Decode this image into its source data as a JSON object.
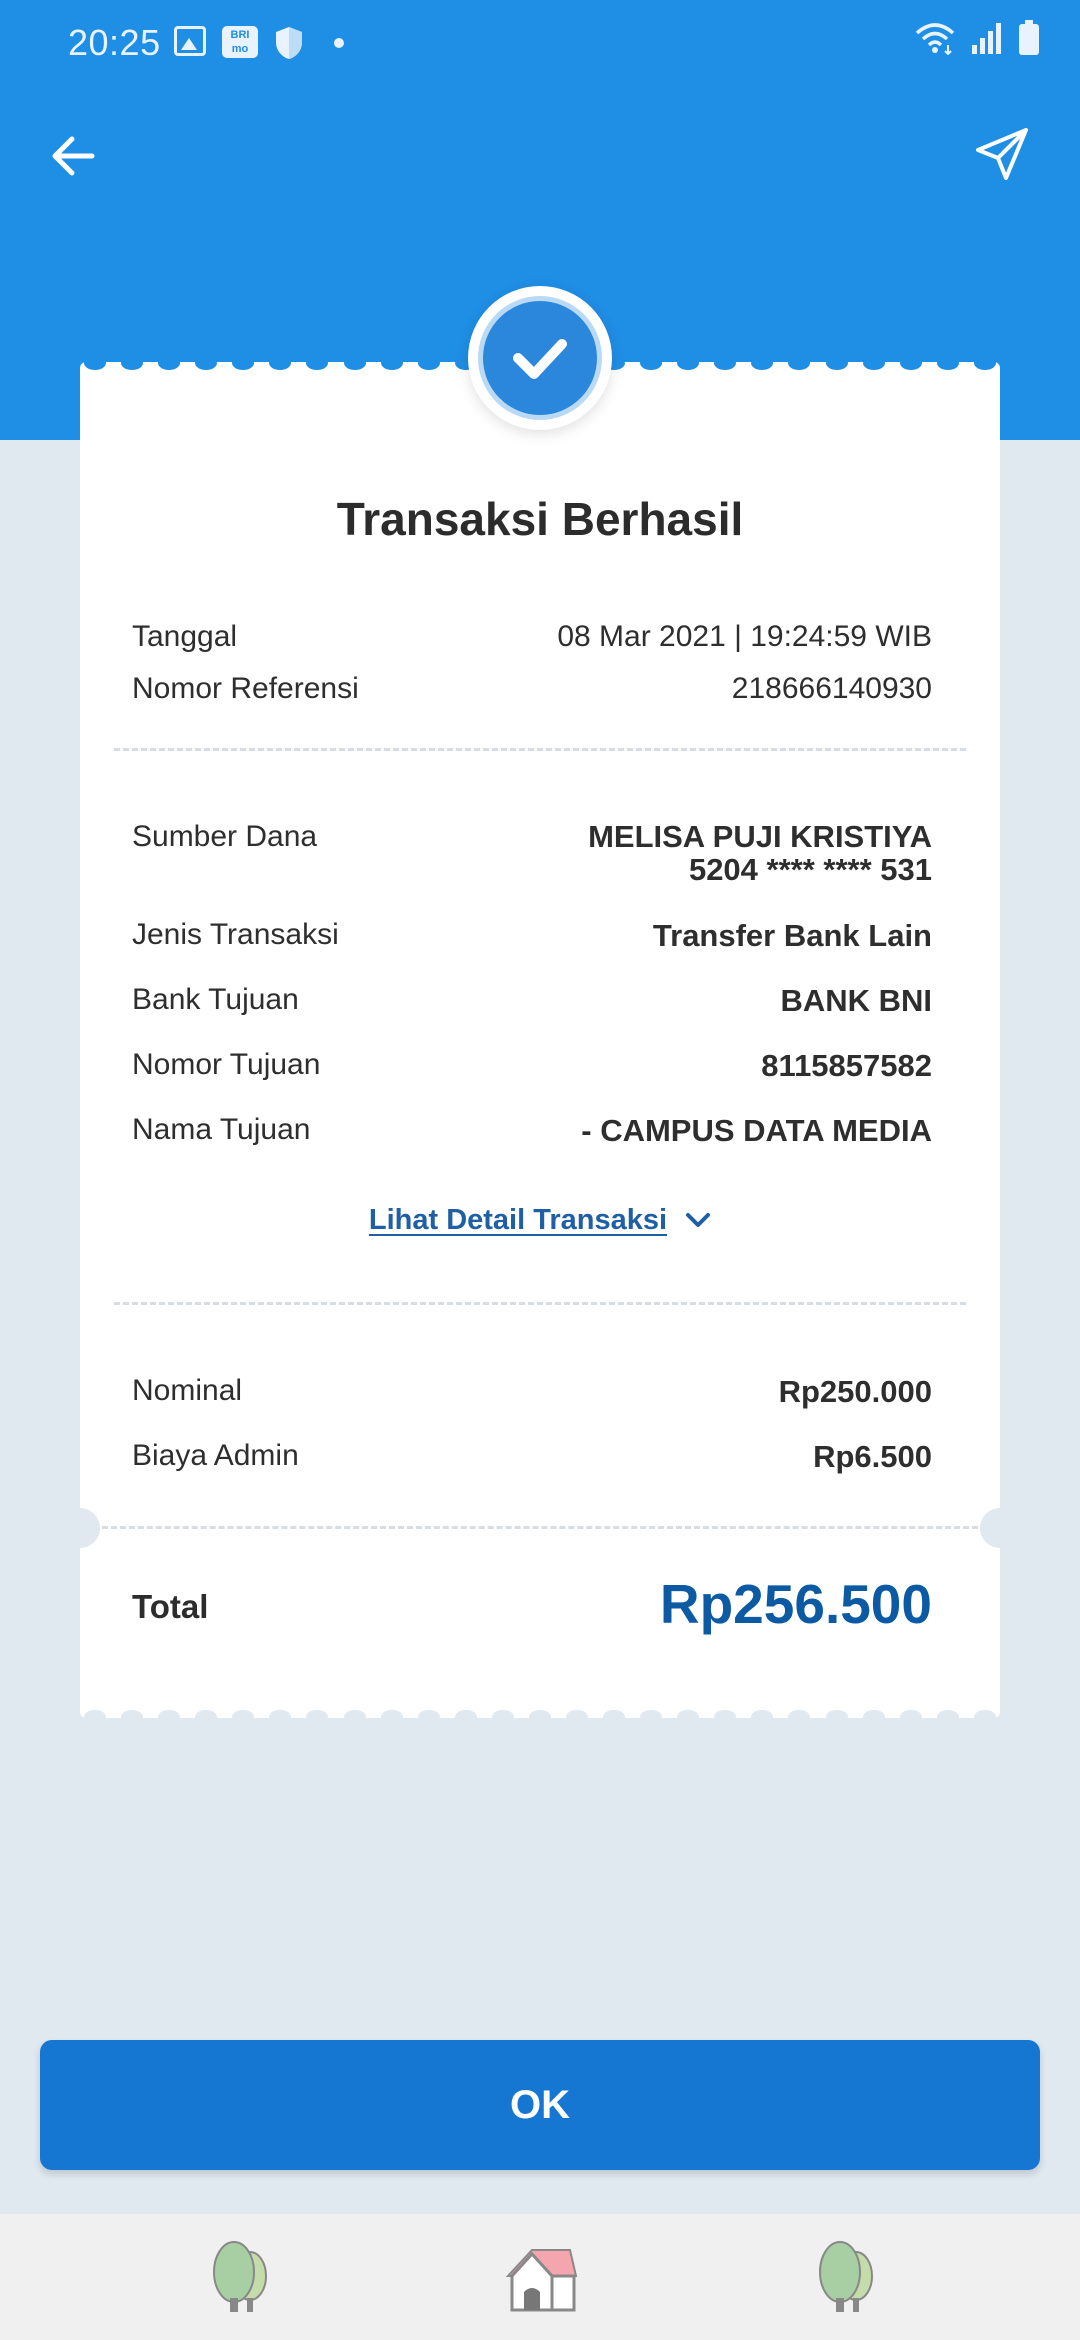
{
  "status_bar": {
    "time": "20:25",
    "brimo_badge": "BRI mo",
    "icons": [
      "gallery-icon",
      "brimo-icon",
      "shield-icon",
      "dot-icon",
      "wifi-icon",
      "signal-icon",
      "battery-icon"
    ]
  },
  "header": {
    "back_icon": "arrow-left-icon",
    "share_icon": "send-icon"
  },
  "receipt": {
    "title": "Transaksi Berhasil",
    "meta": [
      {
        "label": "Tanggal",
        "value": "08 Mar 2021 | 19:24:59 WIB"
      },
      {
        "label": "Nomor Referensi",
        "value": "218666140930"
      }
    ],
    "details": [
      {
        "label": "Sumber Dana",
        "value_line1": "MELISA PUJI KRISTIYA",
        "value_line2": "5204 **** **** 531"
      },
      {
        "label": "Jenis Transaksi",
        "value": "Transfer Bank Lain"
      },
      {
        "label": "Bank Tujuan",
        "value": "BANK BNI"
      },
      {
        "label": "Nomor Tujuan",
        "value": "8115857582"
      },
      {
        "label": "Nama Tujuan",
        "value": "- CAMPUS DATA MEDIA"
      }
    ],
    "detail_link": "Lihat Detail Transaksi",
    "amounts": [
      {
        "label": "Nominal",
        "value": "Rp250.000"
      },
      {
        "label": "Biaya Admin",
        "value": "Rp6.500"
      }
    ],
    "total_label": "Total",
    "total_value": "Rp256.500"
  },
  "ok_button": "OK",
  "bottom_bar": {
    "icons": [
      "tree-icon",
      "house-icon",
      "tree-icon"
    ]
  },
  "colors": {
    "primary": "#1f8ee5",
    "button": "#1577d2",
    "total": "#0b5aa3",
    "background": "#e0e8f0"
  }
}
